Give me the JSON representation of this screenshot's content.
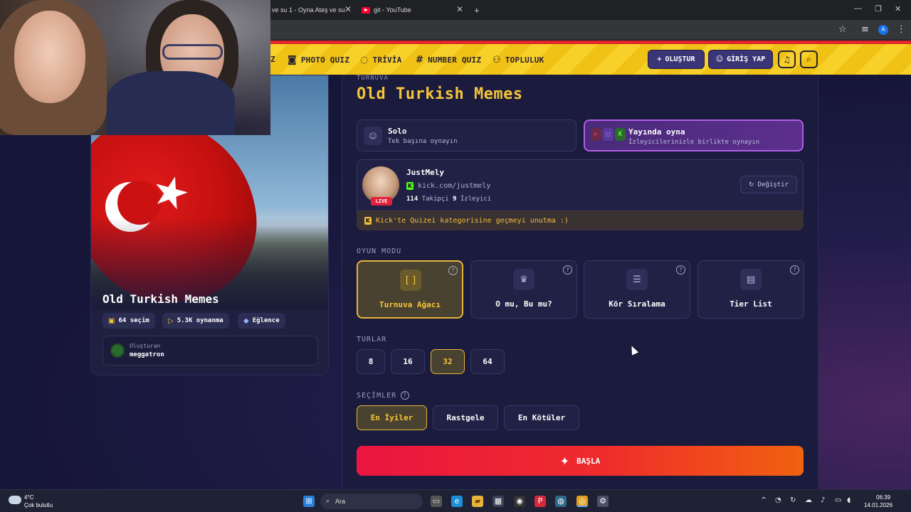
{
  "browser": {
    "tabs": [
      {
        "title": "ve su 1 - Oyna Ateş ve su"
      },
      {
        "title": "git - YouTube"
      }
    ],
    "new_tab": "+"
  },
  "nav": {
    "partial_label": "Z",
    "items": [
      {
        "label": "PHOTO QUIZ",
        "icon": "camera-icon"
      },
      {
        "label": "TRİVİA",
        "icon": "chat-icon"
      },
      {
        "label": "NUMBER QUIZ",
        "icon": "hash-icon"
      },
      {
        "label": "TOPLULUK",
        "icon": "users-icon"
      }
    ],
    "create_label": "OLUŞTUR",
    "login_label": "GİRİŞ YAP"
  },
  "quiz_card": {
    "title": "Old Turkish Memes",
    "choices": "64 seçim",
    "plays": "5.3K oynanma",
    "category": "Eğlence",
    "creator_label": "Oluşturan",
    "creator_name": "meggatron"
  },
  "main": {
    "kicker": "TURNUVA",
    "title": "Old Turkish Memes",
    "solo": {
      "title": "Solo",
      "subtitle": "Tek başına oynayın"
    },
    "stream": {
      "title": "Yayında oyna",
      "subtitle": "İzleyicilerinizle birlikte oynayın"
    },
    "streamer": {
      "name": "JustMely",
      "link": "kick.com/justmely",
      "followers": "114",
      "followers_label": "Takipçi",
      "viewers": "9",
      "viewers_label": "İzleyici",
      "live_badge": "LIVE",
      "change_label": "Değiştir",
      "note": "Kick'te Quizei kategorisine geçmeyi unutma :)"
    },
    "game_mode_label": "OYUN MODU",
    "game_modes": [
      {
        "label": "Turnuva Ağacı",
        "icon": "bracket-icon",
        "selected": true
      },
      {
        "label": "O mu, Bu mu?",
        "icon": "crown-icon",
        "selected": false
      },
      {
        "label": "Kör Sıralama",
        "icon": "list-icon",
        "selected": false
      },
      {
        "label": "Tier List",
        "icon": "rows-icon",
        "selected": false
      }
    ],
    "rounds_label": "TURLAR",
    "rounds": [
      "8",
      "16",
      "32",
      "64"
    ],
    "selected_round": "32",
    "picks_label": "SEÇİMLER",
    "picks": [
      "En İyiler",
      "Rastgele",
      "En Kötüler"
    ],
    "selected_pick": "En İyiler",
    "start_label": "BAŞLA"
  },
  "taskbar": {
    "temp": "4°C",
    "weather": "Çok bulutlu",
    "search": "Ara",
    "time": "06:39",
    "date": "14.01.2026"
  },
  "colors": {
    "accent_yellow": "#f4c53a",
    "kick_green": "#53fc18",
    "start_red": "#ea1540",
    "start_orange": "#f0620f",
    "stream_purple": "#b05ee8"
  }
}
